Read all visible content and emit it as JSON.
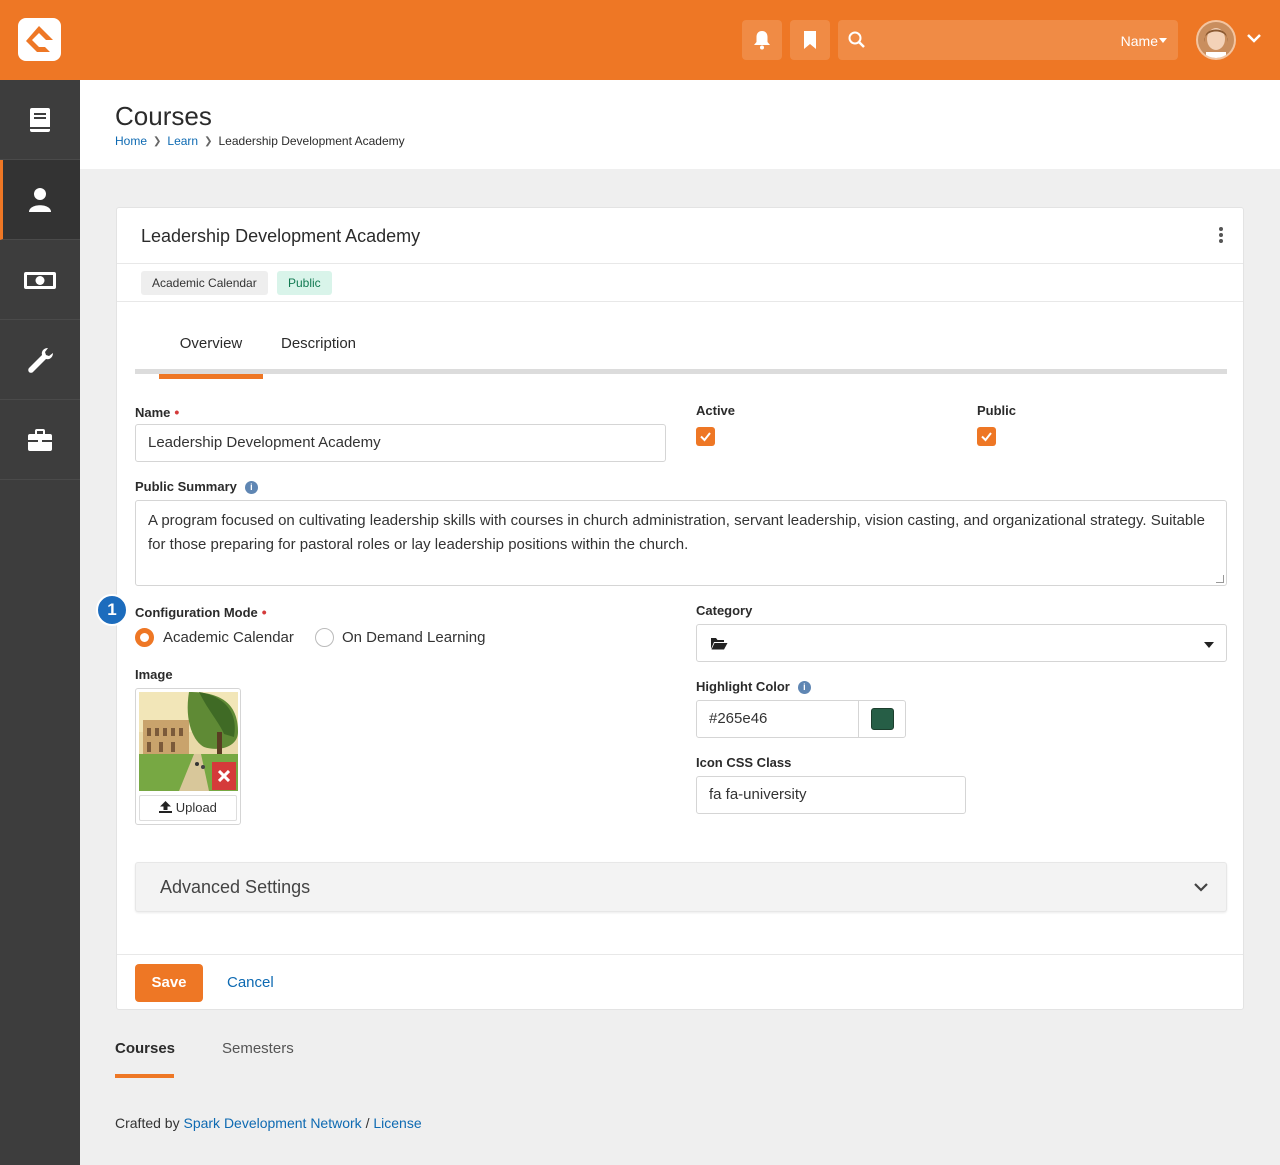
{
  "topbar": {
    "search_scope": "Name",
    "accent": "#ee7725"
  },
  "sidebar": {
    "items": [
      {
        "icon": "book-icon"
      },
      {
        "icon": "person-icon",
        "active": true
      },
      {
        "icon": "money-icon"
      },
      {
        "icon": "wrench-icon"
      },
      {
        "icon": "briefcase-icon"
      }
    ]
  },
  "header": {
    "title": "Courses",
    "breadcrumb": [
      "Home",
      "Learn",
      "Leadership Development Academy"
    ]
  },
  "card": {
    "title": "Leadership Development Academy",
    "badges": [
      "Academic Calendar",
      "Public"
    ],
    "tabs": [
      "Overview",
      "Description"
    ],
    "fields": {
      "name_label": "Name",
      "name_value": "Leadership Development Academy",
      "active_label": "Active",
      "public_label": "Public",
      "summary_label": "Public Summary",
      "summary_value": "A program focused on cultivating leadership skills with courses in church administration, servant leadership, vision casting, and organizational strategy. Suitable for those preparing for pastoral roles or lay leadership positions within the church.",
      "config_label": "Configuration Mode",
      "config_options": [
        "Academic Calendar",
        "On Demand Learning"
      ],
      "category_label": "Category",
      "image_label": "Image",
      "upload_label": "Upload",
      "highlight_label": "Highlight Color",
      "highlight_value": "#265e46",
      "icon_css_label": "Icon CSS Class",
      "icon_css_value": "fa fa-university"
    },
    "step_marker": "1",
    "advanced_title": "Advanced Settings",
    "save_label": "Save",
    "cancel_label": "Cancel"
  },
  "page_tabs": [
    "Courses",
    "Semesters"
  ],
  "footer": {
    "prefix": "Crafted by",
    "org": "Spark Development Network",
    "sep": "/",
    "license": "License"
  }
}
